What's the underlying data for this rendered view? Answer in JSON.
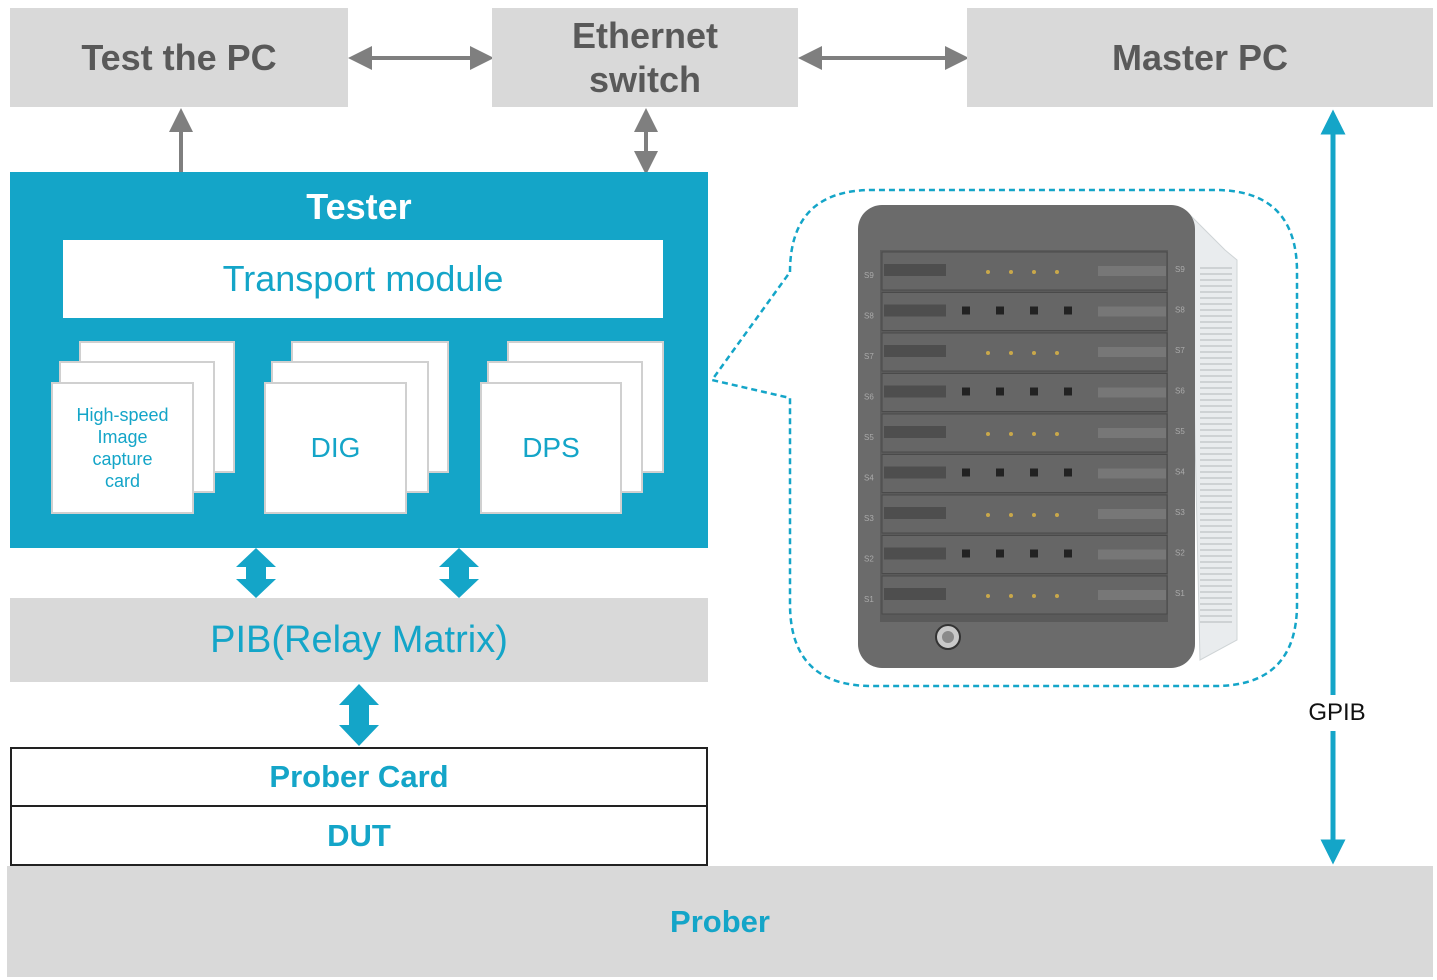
{
  "top_row": {
    "test_pc": "Test the PC",
    "ethernet_switch": "Ethernet switch",
    "master_pc": "Master PC"
  },
  "tester": {
    "title": "Tester",
    "transport_module": "Transport module",
    "cards": [
      {
        "label": "High-speed Image capture card",
        "more": ".."
      },
      {
        "label": "DIG",
        "more": ".."
      },
      {
        "label": "DPS",
        "more": ".."
      }
    ]
  },
  "pib": "PIB(Relay Matrix)",
  "prober_card": "Prober Card",
  "dut": "DUT",
  "prober": "Prober",
  "gpib": "GPIB",
  "rack": {
    "slots": [
      "S9",
      "S8",
      "S7",
      "S6",
      "S5",
      "S4",
      "S3",
      "S2",
      "S1"
    ]
  },
  "colors": {
    "accent": "#14a5c8",
    "box_gray": "#d9d9d9",
    "arrow_gray": "#7f7f7f",
    "text_gray": "#595959"
  }
}
